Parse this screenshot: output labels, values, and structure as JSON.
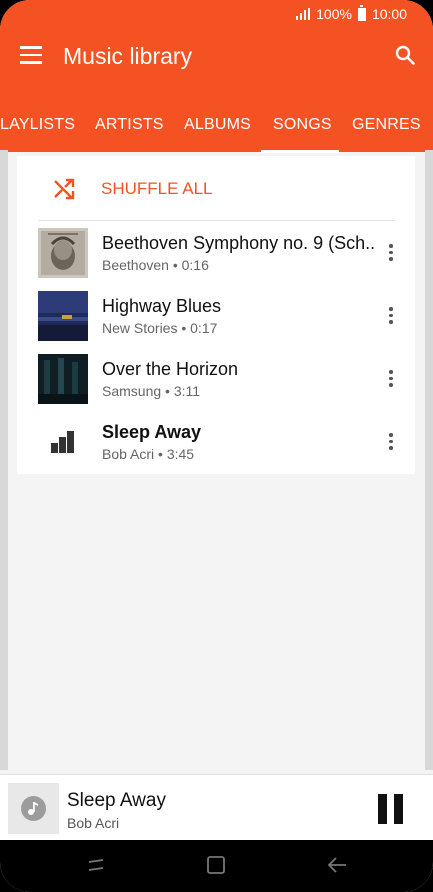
{
  "status": {
    "percent": "100%",
    "time": "10:00"
  },
  "appbar": {
    "title": "Music library"
  },
  "tabs": [
    {
      "label": "LAYLISTS"
    },
    {
      "label": "ARTISTS"
    },
    {
      "label": "ALBUMS"
    },
    {
      "label": "SONGS",
      "selected": true
    },
    {
      "label": "GENRES"
    }
  ],
  "shuffle": {
    "label": "SHUFFLE ALL"
  },
  "songs": [
    {
      "title": "Beethoven Symphony no. 9 (Sch..",
      "subtitle": "Beethoven • 0:16"
    },
    {
      "title": "Highway Blues",
      "subtitle": "New Stories • 0:17"
    },
    {
      "title": "Over the Horizon",
      "subtitle": "Samsung • 3:11"
    },
    {
      "title": "Sleep Away",
      "subtitle": "Bob Acri • 3:45",
      "playing": true
    }
  ],
  "now_playing": {
    "title": "Sleep Away",
    "artist": "Bob Acri"
  },
  "colors": {
    "accent": "#f45223",
    "background": "#f4f4f4"
  }
}
